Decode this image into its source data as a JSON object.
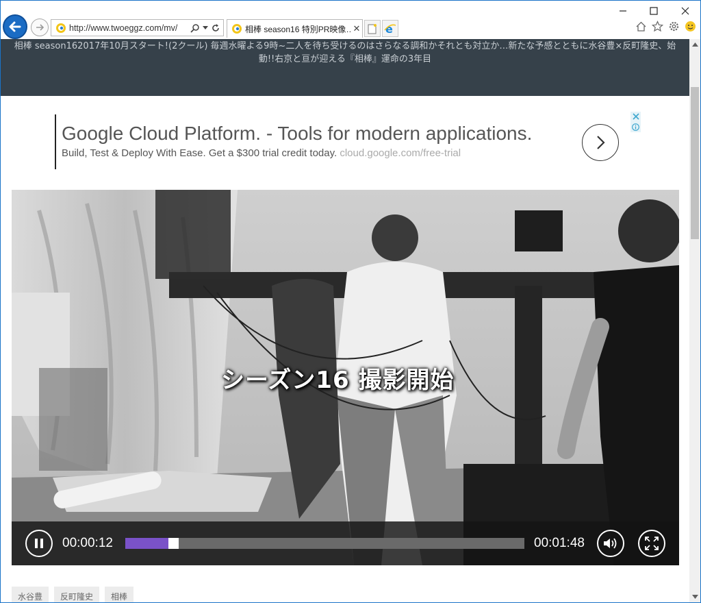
{
  "browser": {
    "address_url": "http://www.twoeggz.com/mv/",
    "tab_title": "相棒 season16 特別PR映像…",
    "tab_close": "✕"
  },
  "page": {
    "banner_text": "相棒 season162017年10月スタート!(2クール) 毎週水曜よる9時~二人を待ち受けるのはさらなる調和かそれとも対立か…新たな予感とともに水谷豊×反町隆史、始動!!右京と亘が迎える『相棒』運命の3年目",
    "ad": {
      "headline": "Google Cloud Platform. - Tools for modern applications.",
      "subtext": "Build, Test & Deploy With Ease. Get a $300 trial credit today.",
      "domain": "cloud.google.com/free-trial"
    },
    "video": {
      "caption": "シーズン16 撮影開始",
      "current_time": "00:00:12",
      "duration": "00:01:48",
      "progress": 0.108,
      "progress_color": "#7a52c8"
    },
    "tags": [
      "水谷豊",
      "反町隆史",
      "相棒"
    ]
  },
  "colors": {
    "banner_bg": "#36414a",
    "back_button": "#1b6cc4"
  }
}
